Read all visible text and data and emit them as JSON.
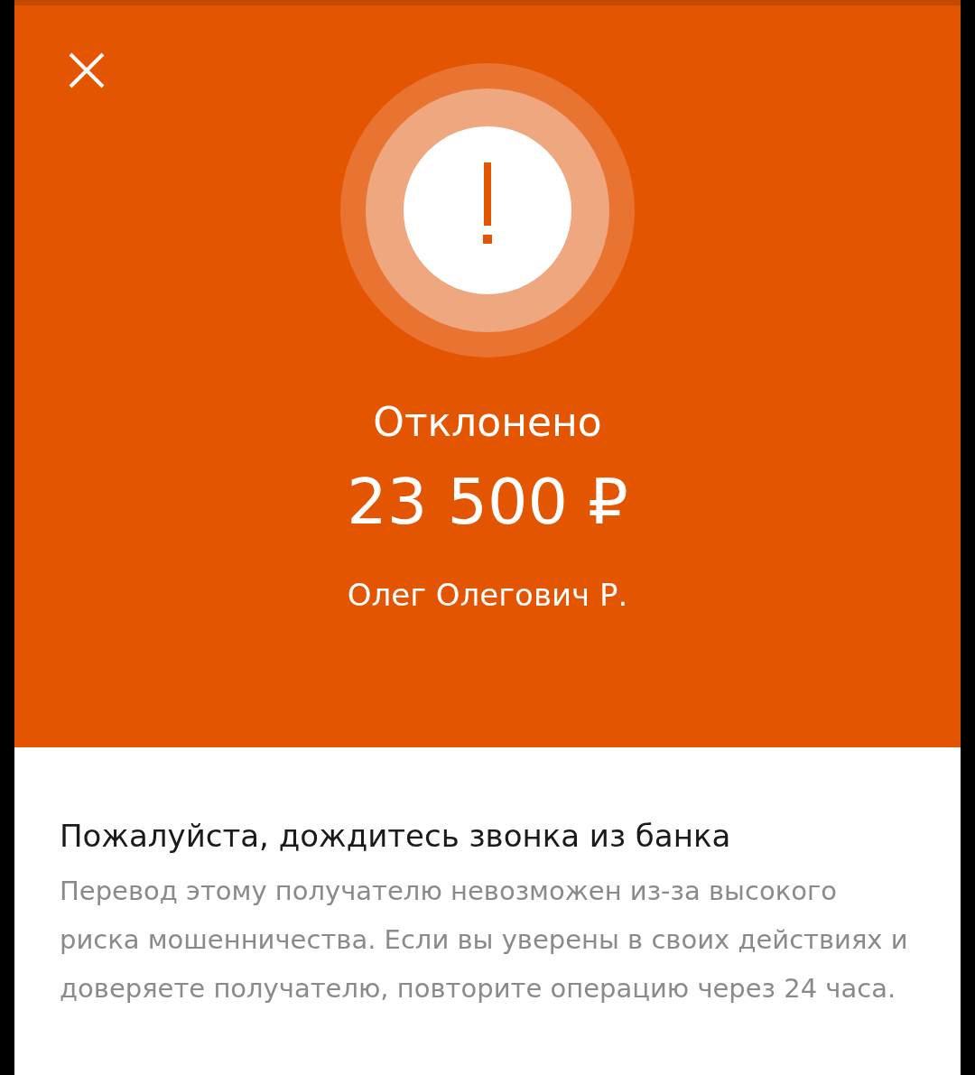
{
  "header": {
    "status": "Отклонено",
    "amount": "23 500 ₽",
    "recipient": "Олег Олегович Р."
  },
  "notice": {
    "title": "Пожалуйста, дождитесь звонка из банка",
    "text": "Перевод этому получателю невозможен из-за высокого риска мошенничества. Если вы уверены в своих действиях и доверяете получателю, повторите операцию через 24 часа."
  }
}
